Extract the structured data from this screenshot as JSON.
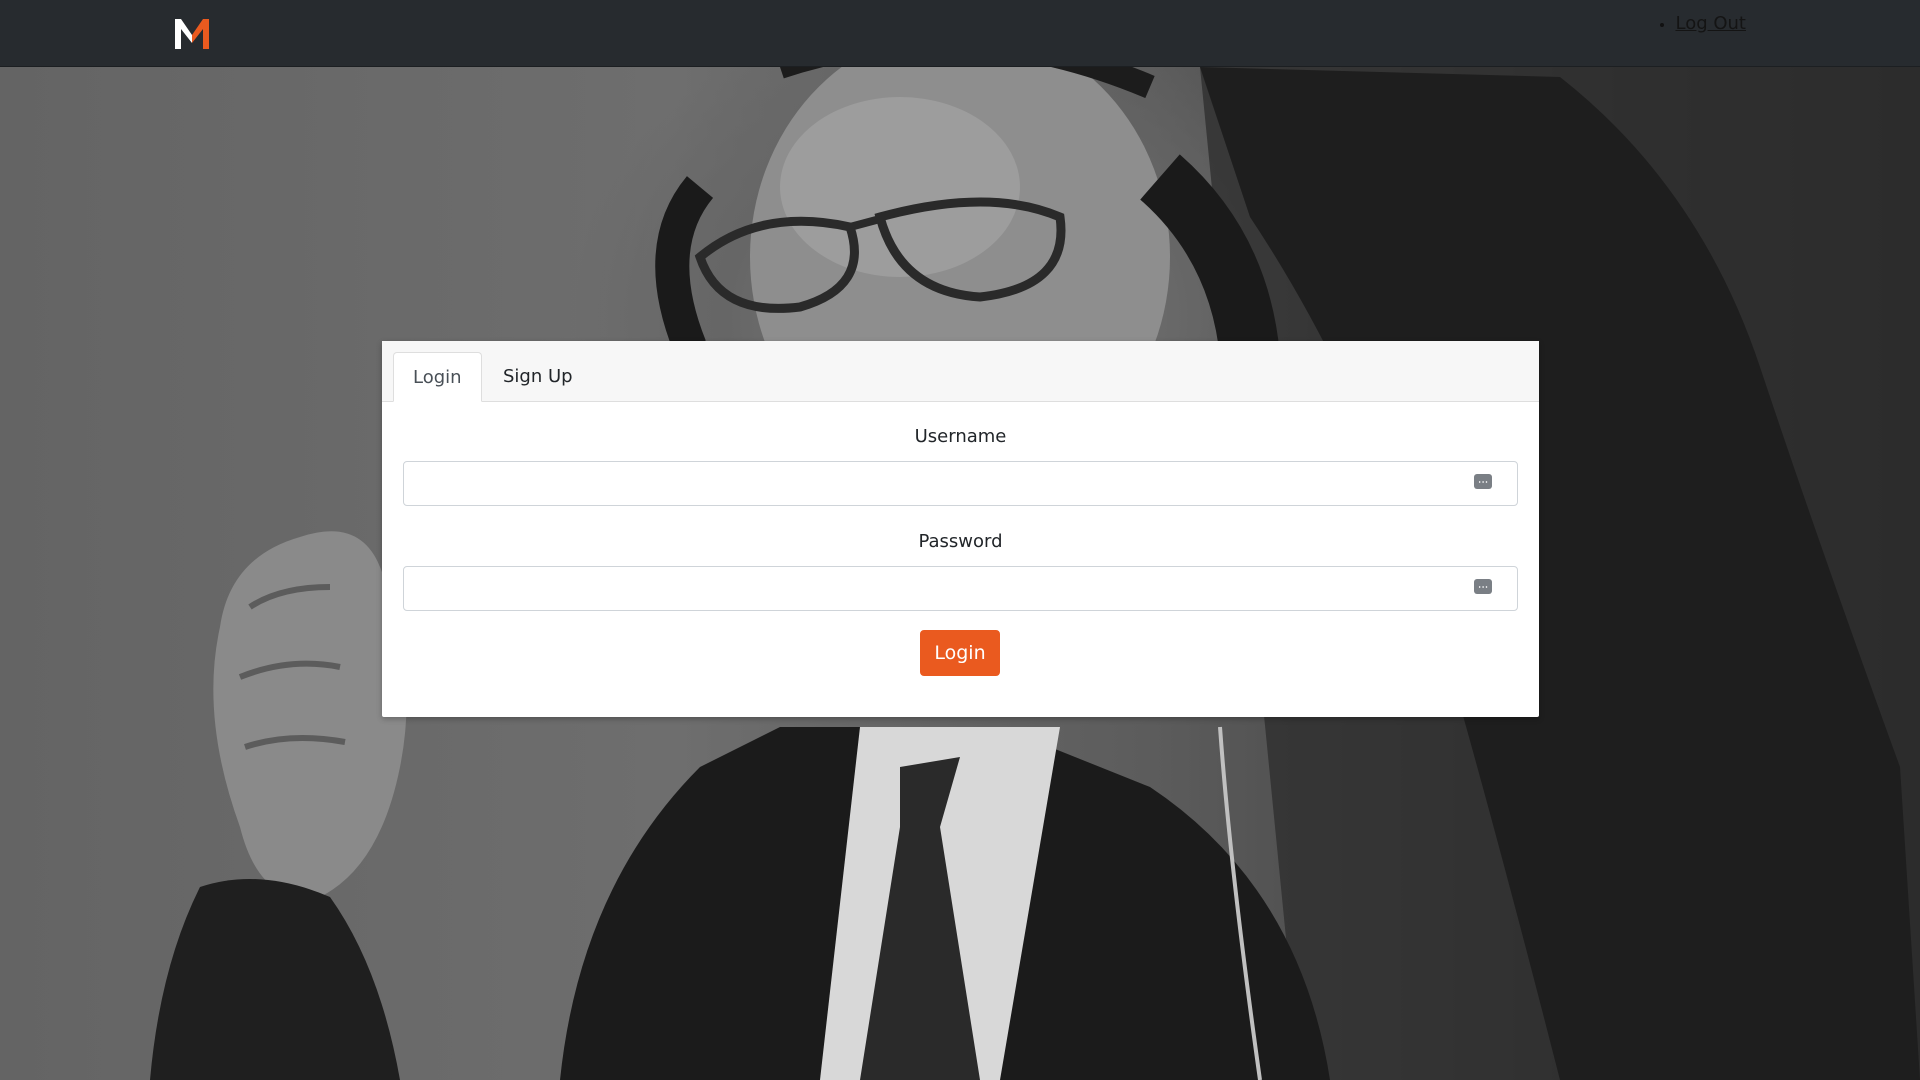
{
  "navbar": {
    "logo": {
      "text": "M",
      "colors": {
        "left": "#ffffff",
        "right": "#ea5a1f"
      }
    },
    "links": [
      {
        "label": "Log Out"
      }
    ]
  },
  "background": {
    "description_icon": "photo-background"
  },
  "auth_card": {
    "tabs": [
      {
        "label": "Login",
        "active": true
      },
      {
        "label": "Sign Up",
        "active": false
      }
    ],
    "username": {
      "label": "Username",
      "value": "",
      "placeholder": ""
    },
    "password": {
      "label": "Password",
      "value": "",
      "placeholder": ""
    },
    "submit_label": "Login"
  },
  "colors": {
    "navbar_bg": "#272b2f",
    "accent": "#ea5a1f",
    "card_bg": "#ffffff"
  }
}
